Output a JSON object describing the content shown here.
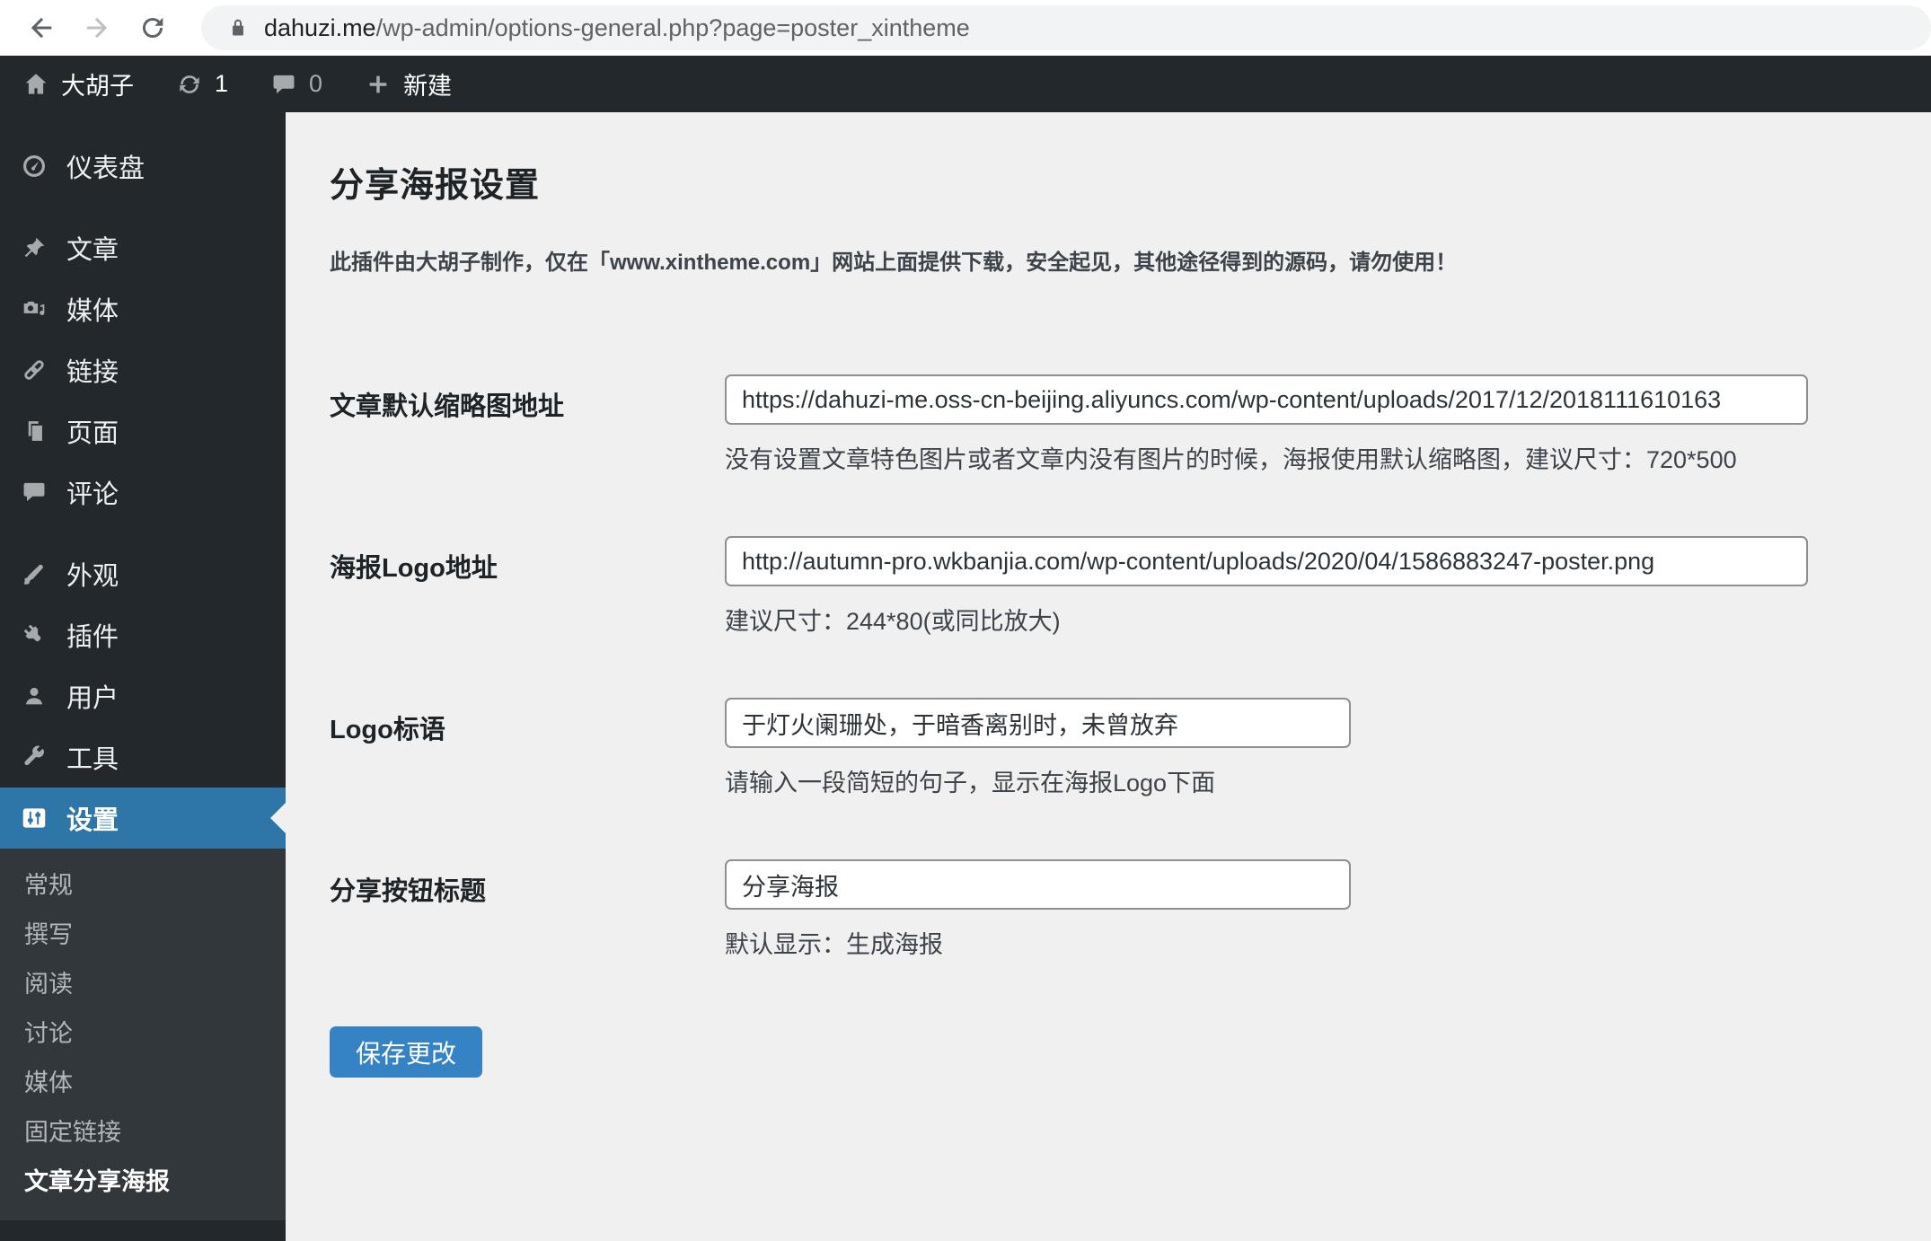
{
  "browser": {
    "url_domain": "dahuzi.me",
    "url_path": "/wp-admin/options-general.php?page=poster_xintheme",
    "icons": [
      "back-arrow-icon",
      "forward-arrow-icon",
      "reload-icon",
      "lock-icon"
    ]
  },
  "admin_bar": {
    "site_name": "大胡子",
    "updates_count": "1",
    "comments_count": "0",
    "new_label": "新建",
    "icons": [
      "home-icon",
      "update-icon",
      "comment-icon",
      "plus-icon"
    ]
  },
  "sidebar": {
    "items": [
      {
        "id": "dashboard",
        "label": "仪表盘",
        "icon": "dashboard",
        "active": false,
        "group_break": false
      },
      {
        "id": "posts",
        "label": "文章",
        "icon": "pin",
        "active": false,
        "group_break": true
      },
      {
        "id": "media",
        "label": "媒体",
        "icon": "media",
        "active": false,
        "group_break": false
      },
      {
        "id": "links",
        "label": "链接",
        "icon": "link",
        "active": false,
        "group_break": false
      },
      {
        "id": "pages",
        "label": "页面",
        "icon": "pages",
        "active": false,
        "group_break": false
      },
      {
        "id": "comments",
        "label": "评论",
        "icon": "comment",
        "active": false,
        "group_break": false
      },
      {
        "id": "appearance",
        "label": "外观",
        "icon": "brush",
        "active": false,
        "group_break": true
      },
      {
        "id": "plugins",
        "label": "插件",
        "icon": "plug",
        "active": false,
        "group_break": false
      },
      {
        "id": "users",
        "label": "用户",
        "icon": "user",
        "active": false,
        "group_break": false
      },
      {
        "id": "tools",
        "label": "工具",
        "icon": "wrench",
        "active": false,
        "group_break": false
      },
      {
        "id": "settings",
        "label": "设置",
        "icon": "sliders",
        "active": true,
        "group_break": false
      }
    ],
    "submenu": [
      {
        "id": "general",
        "label": "常规",
        "current": false
      },
      {
        "id": "writing",
        "label": "撰写",
        "current": false
      },
      {
        "id": "reading",
        "label": "阅读",
        "current": false
      },
      {
        "id": "discussion",
        "label": "讨论",
        "current": false
      },
      {
        "id": "media",
        "label": "媒体",
        "current": false
      },
      {
        "id": "permalinks",
        "label": "固定链接",
        "current": false
      },
      {
        "id": "poster",
        "label": "文章分享海报",
        "current": true
      }
    ]
  },
  "main": {
    "title": "分享海报设置",
    "notice": "此插件由大胡子制作，仅在「www.xintheme.com」网站上面提供下载，安全起见，其他途径得到的源码，请勿使用！",
    "fields": [
      {
        "label": "文章默认缩略图地址",
        "value": "https://dahuzi-me.oss-cn-beijing.aliyuncs.com/wp-content/uploads/2017/12/2018111610163",
        "help": "没有设置文章特色图片或者文章内没有图片的时候，海报使用默认缩略图，建议尺寸：720*500",
        "wide": true
      },
      {
        "label": "海报Logo地址",
        "value": "http://autumn-pro.wkbanjia.com/wp-content/uploads/2020/04/1586883247-poster.png",
        "help": "建议尺寸：244*80(或同比放大)",
        "wide": true
      },
      {
        "label": "Logo标语",
        "value": "于灯火阑珊处，于暗香离别时，未曾放弃",
        "help": "请输入一段简短的句子，显示在海报Logo下面",
        "wide": false
      },
      {
        "label": "分享按钮标题",
        "value": "分享海报",
        "help": "默认显示：生成海报",
        "wide": false
      }
    ],
    "save_label": "保存更改"
  },
  "colors": {
    "sidebar_dark": "#23282d",
    "submenu_dark": "#32373c",
    "active_blue": "#2e75a8",
    "button_blue": "#3582c4",
    "content_bg": "#f0f0f1",
    "input_border": "#8c8f94"
  }
}
